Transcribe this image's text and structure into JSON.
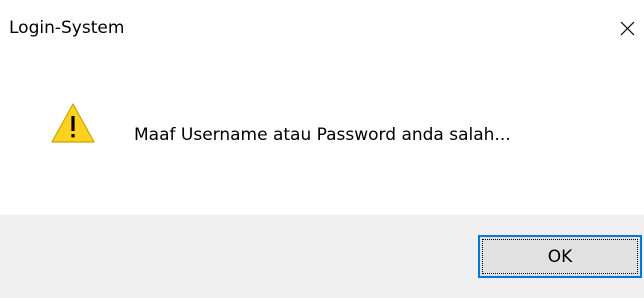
{
  "window": {
    "title": "Login-System",
    "close_icon": "close-icon"
  },
  "message": {
    "icon": "warning-icon",
    "text": "Maaf Username atau Password anda salah..."
  },
  "buttons": {
    "ok_label": "OK"
  },
  "colors": {
    "warning_yellow": "#FFD21F",
    "accent_border": "#0078D7",
    "button_bar": "#F0F0F0",
    "button_face": "#E1E1E1"
  }
}
